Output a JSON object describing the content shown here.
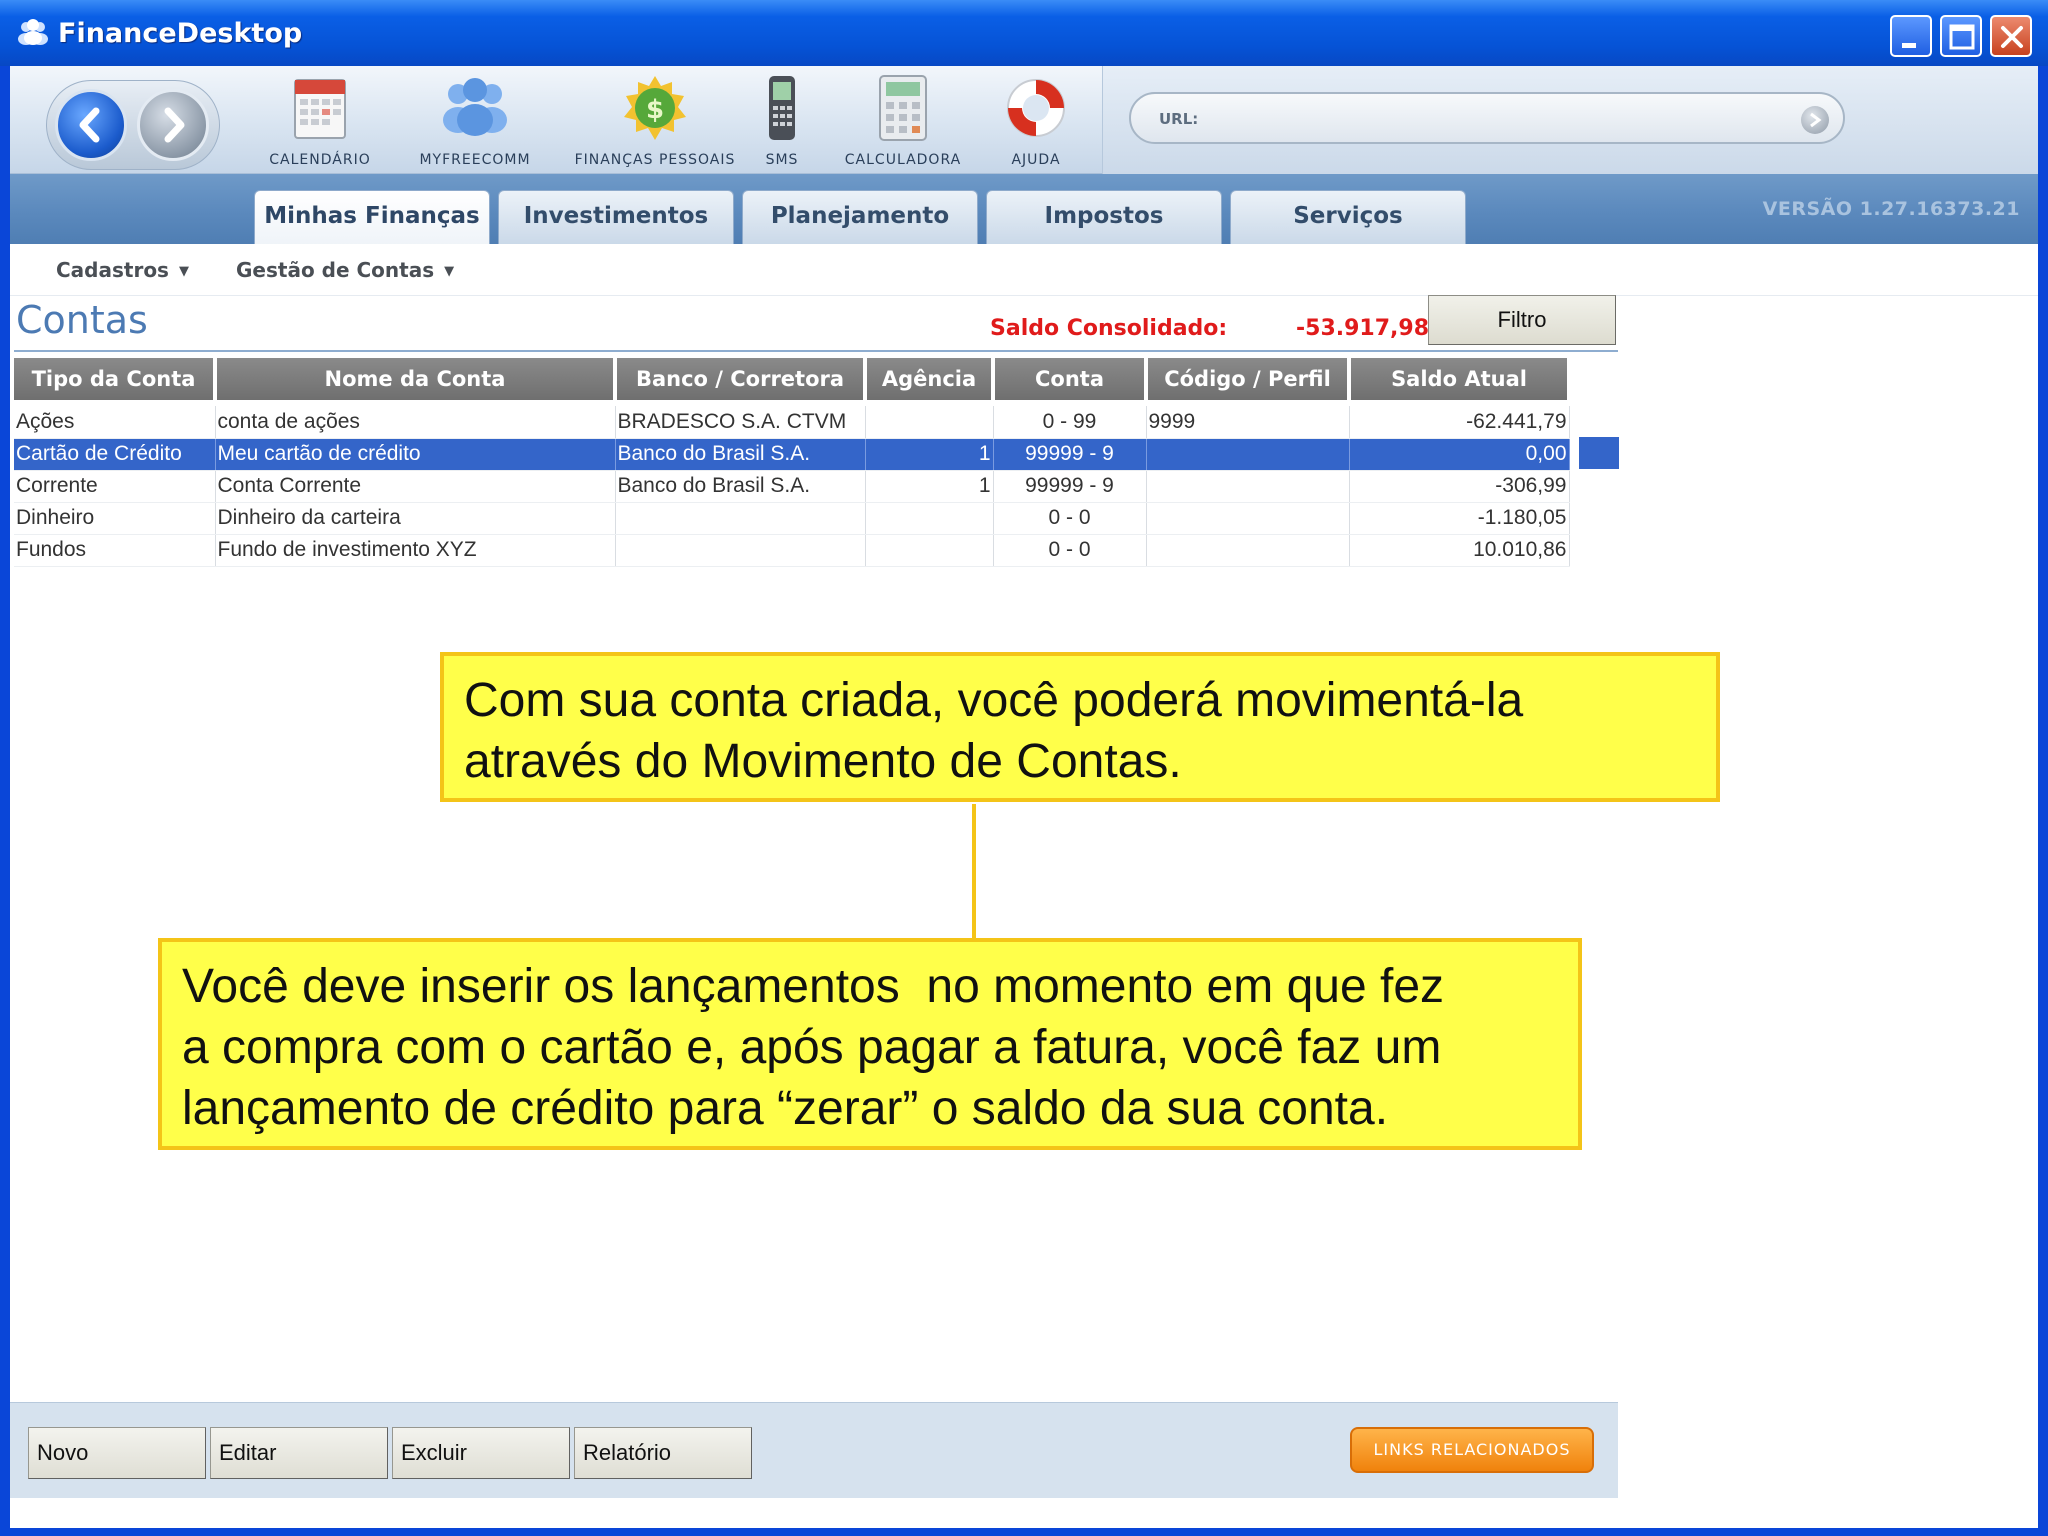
{
  "window": {
    "title": "FinanceDesktop"
  },
  "toolbar": {
    "tools": [
      {
        "label": "CALENDÁRIO",
        "icon": "calendar-icon"
      },
      {
        "label": "MYFREECOMM",
        "icon": "users-icon"
      },
      {
        "label": "FINANÇAS PESSOAIS",
        "icon": "money-icon"
      },
      {
        "label": "SMS",
        "icon": "phone-icon"
      },
      {
        "label": "CALCULADORA",
        "icon": "calculator-icon"
      },
      {
        "label": "AJUDA",
        "icon": "lifebuoy-icon"
      }
    ],
    "url_label": "URL:"
  },
  "tabs": [
    {
      "label": "Minhas Finanças",
      "active": true
    },
    {
      "label": "Investimentos",
      "active": false
    },
    {
      "label": "Planejamento",
      "active": false
    },
    {
      "label": "Impostos",
      "active": false
    },
    {
      "label": "Serviços",
      "active": false
    }
  ],
  "version": "VERSÃO 1.27.16373.21",
  "submenu": [
    {
      "label": "Cadastros"
    },
    {
      "label": "Gestão de Contas"
    }
  ],
  "page": {
    "title": "Contas",
    "saldo_label": "Saldo Consolidado:",
    "saldo_value": "-53.917,98",
    "filter_label": "Filtro"
  },
  "table": {
    "columns": [
      "Tipo da Conta",
      "Nome da Conta",
      "Banco / Corretora",
      "Agência",
      "Conta",
      "Código / Perfil",
      "Saldo Atual"
    ],
    "rows": [
      [
        "Ações",
        "conta de ações",
        "BRADESCO S.A. CTVM",
        "",
        "0 - 99",
        "9999",
        "-62.441,79"
      ],
      [
        "Cartão de Crédito",
        "Meu cartão de crédito",
        "Banco do Brasil S.A.",
        "1",
        "99999 - 9",
        "",
        "0,00"
      ],
      [
        "Corrente",
        "Conta Corrente",
        "Banco do Brasil S.A.",
        "1",
        "99999 - 9",
        "",
        "-306,99"
      ],
      [
        "Dinheiro",
        "Dinheiro da carteira",
        "",
        "",
        "0 - 0",
        "",
        "-1.180,05"
      ],
      [
        "Fundos",
        "Fundo de investimento XYZ",
        "",
        "",
        "0 - 0",
        "",
        "10.010,86"
      ]
    ],
    "selected_row": 1
  },
  "callouts": {
    "top": [
      "Com sua conta criada, você poderá movimentá-la",
      "através do Movimento de Contas."
    ],
    "bottom": [
      "Você deve inserir os lançamentos  no momento em que fez",
      "a compra com o cartão e, após pagar a fatura, você faz um",
      "lançamento de crédito para “zerar” o saldo da sua conta."
    ]
  },
  "buttons": {
    "novo": "Novo",
    "editar": "Editar",
    "excluir": "Excluir",
    "relatorio": "Relatório",
    "links": "LINKS RELACIONADOS"
  },
  "colors": {
    "titlebar": "#0653d6",
    "selection": "#3465c9",
    "saldo": "#e01b1b",
    "callout_fill": "#ffff4a",
    "callout_border": "#f4c418",
    "links_button": "#f0820c"
  }
}
